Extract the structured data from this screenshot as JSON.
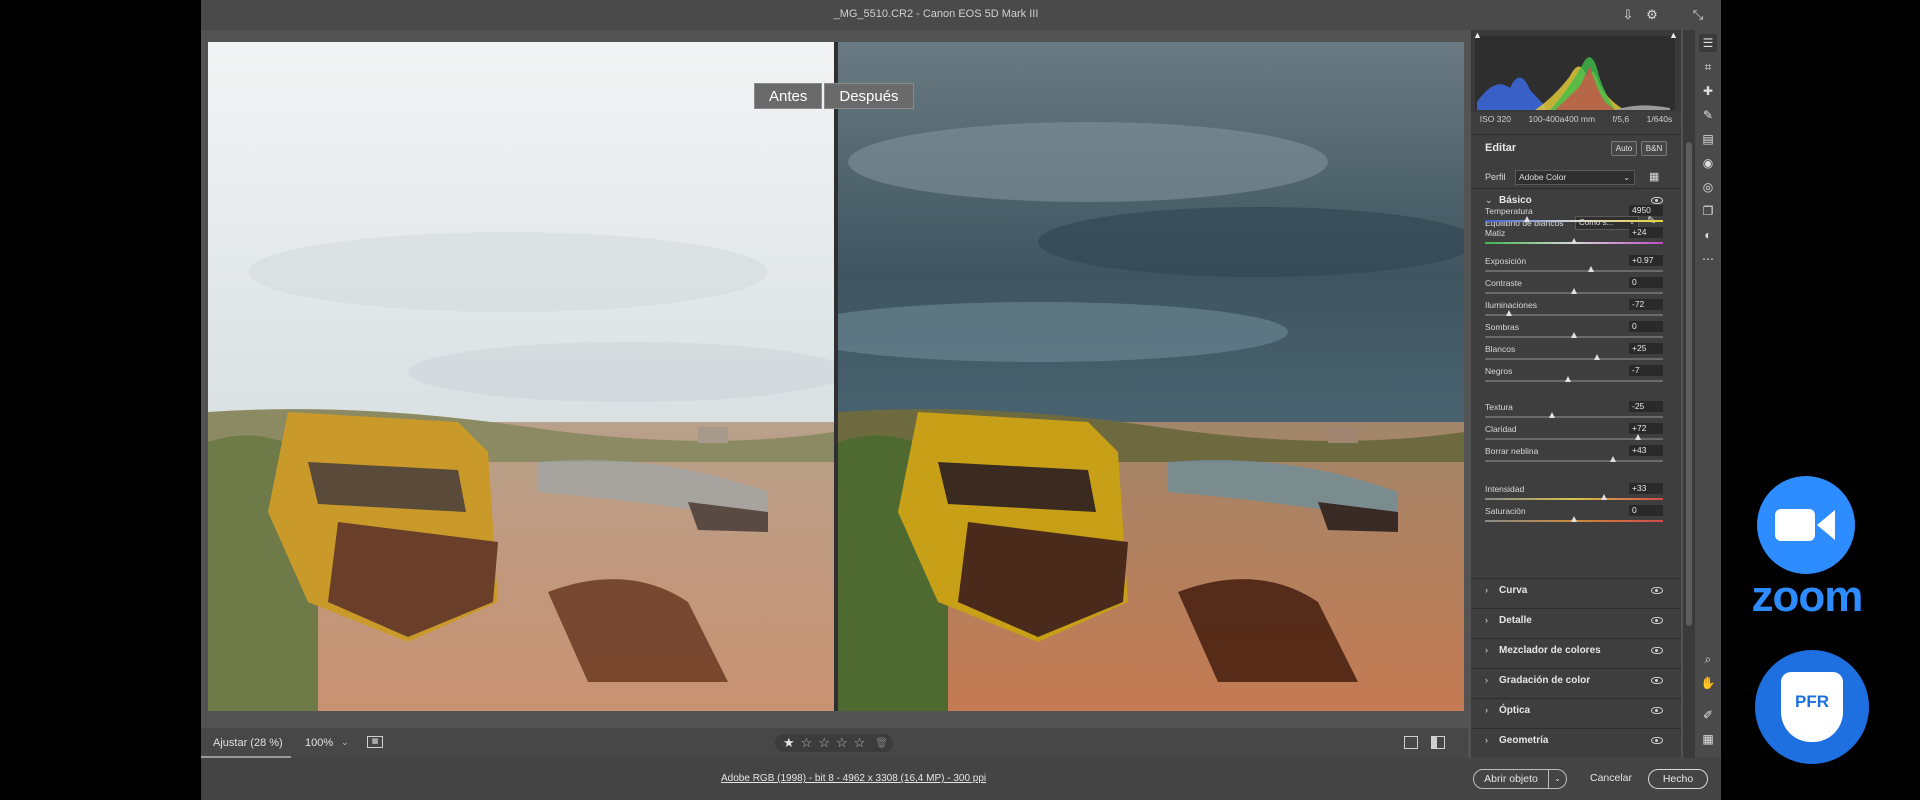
{
  "window": {
    "title": "_MG_5510.CR2 - Canon EOS 5D Mark III"
  },
  "compare": {
    "before": "Antes",
    "after": "Después"
  },
  "image_toolbar": {
    "fit": "Ajustar (28 %)",
    "zoom": "100%",
    "stars": [
      "★",
      "☆",
      "☆",
      "☆",
      "☆"
    ]
  },
  "status": {
    "file_info": "Adobe RGB (1998) - bit 8 - 4962 x 3308 (16,4 MP) - 300 ppi",
    "open": "Abrir objeto",
    "cancel": "Cancelar",
    "done": "Hecho"
  },
  "camera_info": [
    "ISO 320",
    "100-400a400 mm",
    "f/5,6",
    "1/640s"
  ],
  "edit": {
    "title": "Editar",
    "auto": "Auto",
    "bw": "B&N",
    "profile_label": "Perfil",
    "profile_value": "Adobe Color"
  },
  "basic": {
    "title": "Básico",
    "wb_label": "Equilibrio de blancos",
    "wb_value": "Como s...",
    "sliders": [
      {
        "label": "Temperatura",
        "value": "4950",
        "pos": 0.24,
        "track": "temp"
      },
      {
        "label": "Matiz",
        "value": "+24",
        "pos": 0.5,
        "track": "tint"
      },
      {
        "label": "Exposición",
        "value": "+0.97",
        "pos": 0.6,
        "track": "plain"
      },
      {
        "label": "Contraste",
        "value": "0",
        "pos": 0.5,
        "track": "plain"
      },
      {
        "label": "Iluminaciones",
        "value": "-72",
        "pos": 0.14,
        "track": "plain"
      },
      {
        "label": "Sombras",
        "value": "0",
        "pos": 0.5,
        "track": "plain"
      },
      {
        "label": "Blancos",
        "value": "+25",
        "pos": 0.63,
        "track": "plain"
      },
      {
        "label": "Negros",
        "value": "-7",
        "pos": 0.47,
        "track": "plain"
      },
      {
        "label": "Textura",
        "value": "-25",
        "pos": 0.38,
        "track": "plain"
      },
      {
        "label": "Claridad",
        "value": "+72",
        "pos": 0.86,
        "track": "plain"
      },
      {
        "label": "Borrar neblina",
        "value": "+43",
        "pos": 0.72,
        "track": "plain"
      },
      {
        "label": "Intensidad",
        "value": "+33",
        "pos": 0.67,
        "track": "vib"
      },
      {
        "label": "Saturación",
        "value": "0",
        "pos": 0.5,
        "track": "sat"
      }
    ]
  },
  "sections": [
    "Curva",
    "Detalle",
    "Mezclador de colores",
    "Gradación de color",
    "Óptica",
    "Geometría"
  ],
  "logos": {
    "zoom": "zoom",
    "pfr": "PFR"
  },
  "colors": {
    "zoom_blue": "#2d8cff",
    "pfr_blue": "#1e6fe0",
    "panel": "#3e3e3e",
    "app_bg": "#535353"
  }
}
